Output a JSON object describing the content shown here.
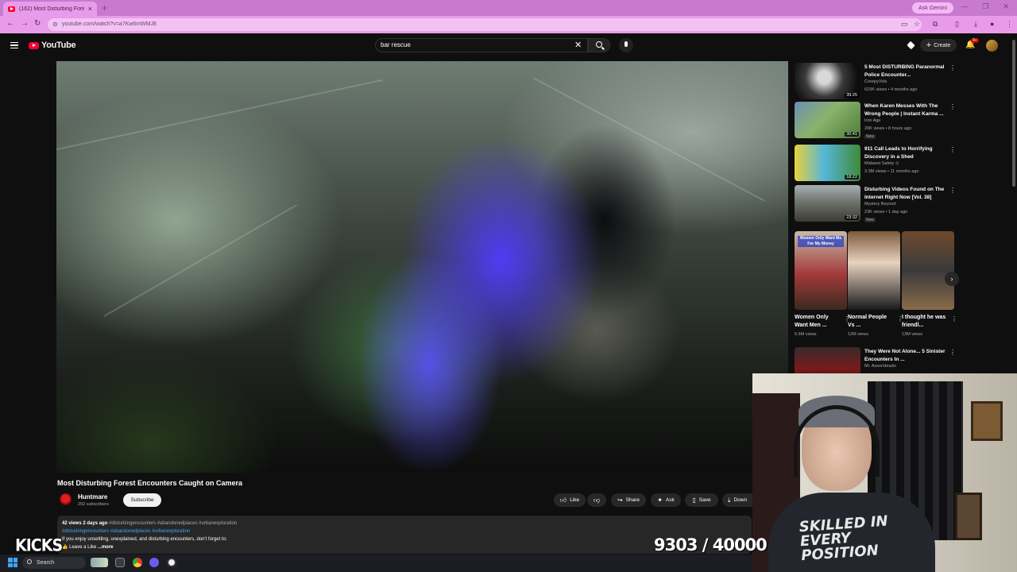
{
  "browser": {
    "tab_title": "(162) Most Disturbing Fore...",
    "tab_close": "×",
    "new_tab": "+",
    "url": "youtube.com/watch?v=a7Kw6mWMJ8",
    "ask_gemini": "Ask Gemini",
    "win_minimize": "—",
    "win_restore": "❐",
    "win_close": "✕"
  },
  "youtube": {
    "logo_text": "YouTube",
    "search_value": "bar rescue",
    "create_label": "Create",
    "notification_count": "9+"
  },
  "video": {
    "title": "Most Disturbing Forest Encounters Caught on Camera",
    "channel_name": "Huntmare",
    "subscribers": "292 subscribers",
    "subscribe_label": "Subscribe",
    "actions": {
      "like": "Like",
      "share": "Share",
      "ask": "Ask",
      "save": "Save",
      "download": "Down"
    },
    "description": {
      "meta": "42 views  2 days ago",
      "meta_tags": "#disturbingencounters #abandonedplaces #urbanexploration",
      "tags_line": "#disturbingencounters #abandonedplaces #urbanexploration",
      "line1": "If you enjoy unsettling, unexplained, and disturbing encounters, don't forget to:",
      "line2": "👍 Leave a Like",
      "more": "...more"
    }
  },
  "sidebar": {
    "recommendations": [
      {
        "title": "5 Most DISTURBING Paranormal Police Encounter...",
        "channel": "CreepyVids",
        "views": "615K views • 4 months ago",
        "duration": "39:25",
        "new": ""
      },
      {
        "title": "When Karen Messes With The Wrong People | Instant Karma ...",
        "channel": "Iron Age",
        "views": "20K views • 8 hours ago",
        "duration": "30:41",
        "new": "New"
      },
      {
        "title": "911 Call Leads to Horrifying Discovery in a Shed",
        "channel": "Midwest Safety ⊙",
        "views": "3.3M views • 11 months ago",
        "duration": "18:22",
        "new": ""
      },
      {
        "title": "Disturbing Videos Found on The Internet Right Now [Vol. 38]",
        "channel": "Mystery Beyond",
        "views": "23K views • 1 day ago",
        "duration": "23:32",
        "new": "New"
      },
      {
        "title": "They Were Not Alone... 5 Sinister Encounters In ...",
        "channel": "Mr. Assombrado",
        "views": "",
        "duration": "",
        "new": ""
      }
    ],
    "shorts": [
      {
        "title": "Women Only Want Men ...",
        "views": "6.6M views",
        "overlay": "Women Only Want Me For My Money"
      },
      {
        "title": "Normal People Vs ...",
        "views": "12M views",
        "overlay": ""
      },
      {
        "title": "I thought he was friendl...",
        "views": "13M views",
        "overlay": ""
      }
    ],
    "shorts_next": "›"
  },
  "webcam": {
    "shirt_text": "SKILLED IN EVERY POSITION"
  },
  "overlays": {
    "kicks": "KICKS",
    "goal": "9303 / 40000"
  },
  "taskbar": {
    "search_label": "Search"
  }
}
